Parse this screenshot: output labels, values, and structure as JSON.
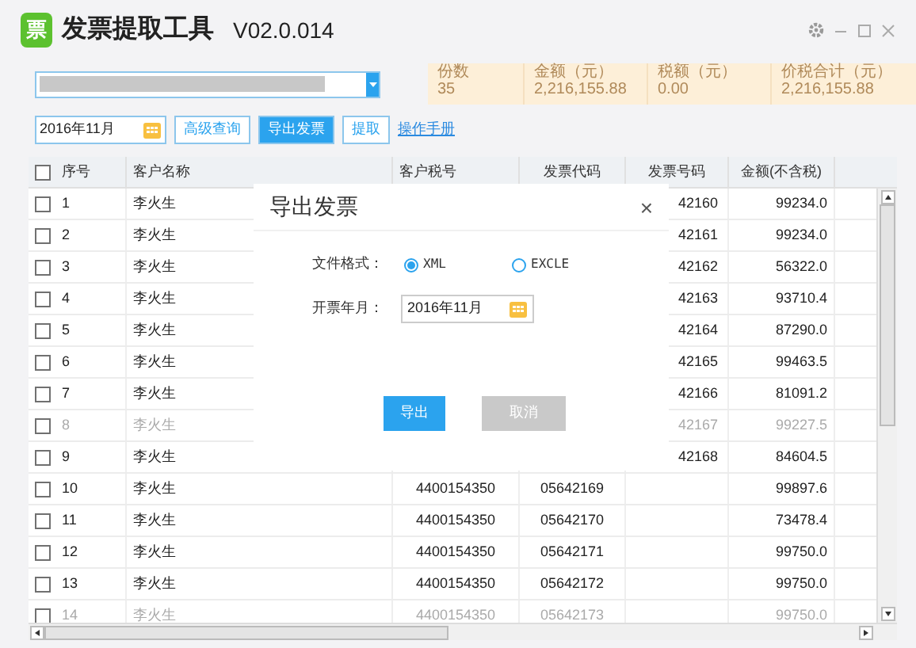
{
  "window": {
    "logo": "票",
    "title": "发票提取工具",
    "version": "V02.0.014"
  },
  "summary": [
    {
      "label": "份数",
      "value": "35"
    },
    {
      "label": "金额（元）",
      "value": "2,216,155.88"
    },
    {
      "label": "税额（元）",
      "value": "0.00"
    },
    {
      "label": "价税合计（元）",
      "value": "2,216,155.88"
    }
  ],
  "toolbar": {
    "month": "2016年11月",
    "buttons": [
      {
        "label": "高级查询",
        "selected": false
      },
      {
        "label": "导出发票",
        "selected": true
      },
      {
        "label": "提取",
        "selected": false
      }
    ],
    "link": "操作手册"
  },
  "table": {
    "all_checked": false,
    "columns": [
      "序号",
      "客户名称",
      "客户税号",
      "发票代码",
      "发票号码",
      "金额(不含税)"
    ],
    "rows": [
      {
        "seq": "1",
        "name": "李火生",
        "number": "42160",
        "amount": "99234.0",
        "checked": false,
        "disabled": false
      },
      {
        "seq": "2",
        "name": "李火生",
        "number": "42161",
        "amount": "99234.0",
        "checked": false,
        "disabled": false
      },
      {
        "seq": "3",
        "name": "李火生",
        "number": "42162",
        "amount": "56322.0",
        "checked": false,
        "disabled": false
      },
      {
        "seq": "4",
        "name": "李火生",
        "number": "42163",
        "amount": "93710.4",
        "checked": false,
        "disabled": false
      },
      {
        "seq": "5",
        "name": "李火生",
        "number": "42164",
        "amount": "87290.0",
        "checked": false,
        "disabled": false
      },
      {
        "seq": "6",
        "name": "李火生",
        "number": "42165",
        "amount": "99463.5",
        "checked": false,
        "disabled": false
      },
      {
        "seq": "7",
        "name": "李火生",
        "number": "42166",
        "amount": "81091.2",
        "checked": false,
        "disabled": false
      },
      {
        "seq": "8",
        "name": "李火生",
        "number": "42167",
        "amount": "99227.5",
        "checked": false,
        "disabled": true
      },
      {
        "seq": "9",
        "name": "李火生",
        "number": "42168",
        "amount": "84604.5",
        "checked": false,
        "disabled": false
      },
      {
        "seq": "10",
        "name": "李火生",
        "tax_id": "4400154350",
        "code": "05642169",
        "amount": "99897.6",
        "checked": false,
        "disabled": false
      },
      {
        "seq": "11",
        "name": "李火生",
        "tax_id": "4400154350",
        "code": "05642170",
        "amount": "73478.4",
        "checked": false,
        "disabled": false
      },
      {
        "seq": "12",
        "name": "李火生",
        "tax_id": "4400154350",
        "code": "05642171",
        "amount": "99750.0",
        "checked": false,
        "disabled": false
      },
      {
        "seq": "13",
        "name": "李火生",
        "tax_id": "4400154350",
        "code": "05642172",
        "amount": "99750.0",
        "checked": false,
        "disabled": false
      },
      {
        "seq": "14",
        "name": "李火生",
        "tax_id": "4400154350",
        "code": "05642173",
        "amount": "99750.0",
        "checked": false,
        "disabled": true
      }
    ]
  },
  "dialog": {
    "title": "导出发票",
    "close": "×",
    "format_label": "文件格式：",
    "formats": [
      {
        "label": "XML",
        "selected": true
      },
      {
        "label": "EXCLE",
        "selected": false
      }
    ],
    "month_label": "开票年月：",
    "month": "2016年11月",
    "buttons": [
      {
        "label": "导出",
        "kind": "primary"
      },
      {
        "label": "取消",
        "kind": "secondary"
      }
    ]
  }
}
